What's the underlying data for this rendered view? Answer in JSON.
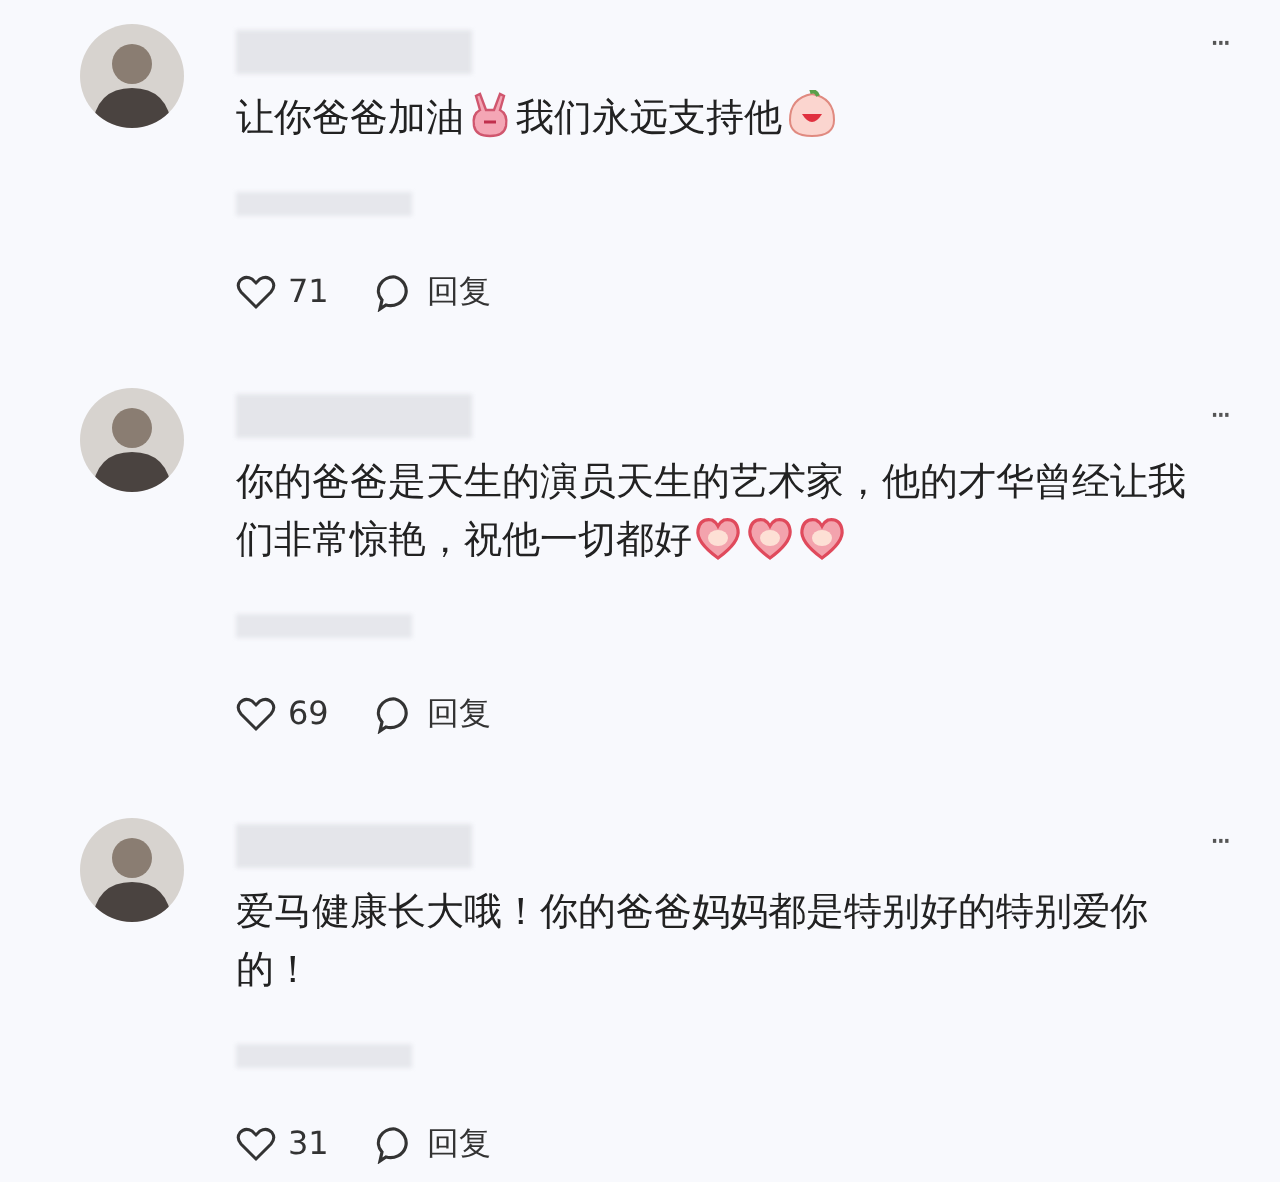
{
  "comments": [
    {
      "segments": [
        {
          "kind": "text",
          "text": "让你爸爸加油"
        },
        {
          "kind": "peace-sticker"
        },
        {
          "kind": "text",
          "text": "我们永远支持他"
        },
        {
          "kind": "blob-sticker"
        }
      ],
      "likes": "71",
      "reply": "回复",
      "more": "···"
    },
    {
      "segments": [
        {
          "kind": "text",
          "text": "你的爸爸是天生的演员天生的艺术家，他的才华曾经让我们非常惊艳，祝他一切都好"
        },
        {
          "kind": "heart-sticker"
        },
        {
          "kind": "heart-sticker"
        },
        {
          "kind": "heart-sticker"
        }
      ],
      "likes": "69",
      "reply": "回复",
      "more": "···"
    },
    {
      "segments": [
        {
          "kind": "text",
          "text": "爱马健康长大哦！你的爸爸妈妈都是特别好的特别爱你的！"
        }
      ],
      "likes": "31",
      "reply": "回复",
      "more": "···"
    }
  ]
}
